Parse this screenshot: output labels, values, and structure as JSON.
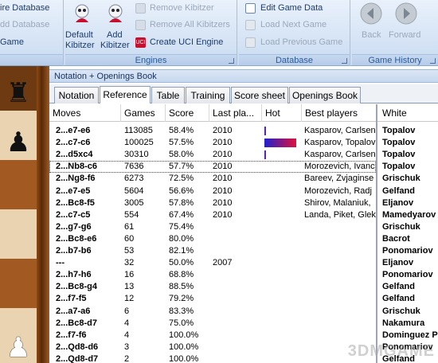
{
  "ribbon": {
    "left_group": {
      "items": [
        "ire Database",
        "dd Database",
        "Game"
      ]
    },
    "engines": {
      "label": "Engines",
      "default_kibitzer_line1": "Default",
      "default_kibitzer_line2": "Kibitzer",
      "add_kibitzer_line1": "Add",
      "add_kibitzer_line2": "Kibitzer",
      "remove_kibitzer": "Remove Kibitzer",
      "remove_all_kibitzers": "Remove All Kibitzers",
      "create_uci_engine": "Create UCI Engine"
    },
    "database": {
      "label": "Database",
      "edit_game_data": "Edit Game Data",
      "load_next_game": "Load Next Game",
      "load_previous_game": "Load Previous Game"
    },
    "game_history": {
      "label": "Game History",
      "back": "Back",
      "forward": "Forward"
    }
  },
  "panel": {
    "title": "Notation + Openings Book",
    "tabs": [
      "Notation",
      "Reference",
      "Table",
      "Training",
      "Score sheet",
      "Openings Book"
    ],
    "active_tab": "Reference"
  },
  "tree": {
    "columns": [
      "Moves",
      "Games",
      "Score",
      "Last pla...",
      "Hot",
      "Best players"
    ],
    "rows": [
      {
        "move": "2...e7-e6",
        "games": "113085",
        "score": "58.4%",
        "last": "2010",
        "hot": 0.06,
        "players": "Kasparov, Carlsen"
      },
      {
        "move": "2...c7-c6",
        "games": "100025",
        "score": "57.5%",
        "last": "2010",
        "hot": 1.0,
        "players": "Kasparov, Topalov"
      },
      {
        "move": "2...d5xc4",
        "games": "30310",
        "score": "58.0%",
        "last": "2010",
        "hot": 0.05,
        "players": "Kasparov, Carlsen"
      },
      {
        "move": "2...Nb8-c6",
        "games": "7636",
        "score": "57.7%",
        "last": "2010",
        "hot": 0,
        "players": "Morozevich, Ivanc"
      },
      {
        "move": "2...Ng8-f6",
        "games": "6273",
        "score": "72.5%",
        "last": "2010",
        "hot": 0,
        "players": "Bareev, Zvjaginse"
      },
      {
        "move": "2...e7-e5",
        "games": "5604",
        "score": "56.6%",
        "last": "2010",
        "hot": 0,
        "players": "Morozevich, Radj"
      },
      {
        "move": "2...Bc8-f5",
        "games": "3005",
        "score": "57.8%",
        "last": "2010",
        "hot": 0,
        "players": "Shirov, Malaniuk,"
      },
      {
        "move": "2...c7-c5",
        "games": "554",
        "score": "67.4%",
        "last": "2010",
        "hot": 0,
        "players": "Landa, Piket, Glek"
      },
      {
        "move": "2...g7-g6",
        "games": "61",
        "score": "75.4%",
        "last": "",
        "hot": 0,
        "players": ""
      },
      {
        "move": "2...Bc8-e6",
        "games": "60",
        "score": "80.0%",
        "last": "",
        "hot": 0,
        "players": ""
      },
      {
        "move": "2...b7-b6",
        "games": "53",
        "score": "82.1%",
        "last": "",
        "hot": 0,
        "players": ""
      },
      {
        "move": "---",
        "games": "32",
        "score": "50.0%",
        "last": "2007",
        "hot": 0,
        "players": ""
      },
      {
        "move": "2...h7-h6",
        "games": "16",
        "score": "68.8%",
        "last": "",
        "hot": 0,
        "players": ""
      },
      {
        "move": "2...Bc8-g4",
        "games": "13",
        "score": "88.5%",
        "last": "",
        "hot": 0,
        "players": ""
      },
      {
        "move": "2...f7-f5",
        "games": "12",
        "score": "79.2%",
        "last": "",
        "hot": 0,
        "players": ""
      },
      {
        "move": "2...a7-a6",
        "games": "6",
        "score": "83.3%",
        "last": "",
        "hot": 0,
        "players": ""
      },
      {
        "move": "2...Bc8-d7",
        "games": "4",
        "score": "75.0%",
        "last": "",
        "hot": 0,
        "players": ""
      },
      {
        "move": "2...f7-f6",
        "games": "4",
        "score": "100.0%",
        "last": "",
        "hot": 0,
        "players": ""
      },
      {
        "move": "2...Qd8-d6",
        "games": "3",
        "score": "100.0%",
        "last": "",
        "hot": 0,
        "players": ""
      },
      {
        "move": "2...Qd8-d7",
        "games": "2",
        "score": "100.0%",
        "last": "",
        "hot": 0,
        "players": ""
      }
    ]
  },
  "players_panel": {
    "header": "White",
    "names": [
      "Topalov",
      "Topalov",
      "Topalov",
      "Topalov",
      "Grischuk",
      "Gelfand",
      "Eljanov",
      "Mamedyarov",
      "Grischuk",
      "Bacrot",
      "Ponomariov",
      "Eljanov",
      "Ponomariov",
      "Gelfand",
      "Gelfand",
      "Grischuk",
      "Nakamura",
      "Dominguez Pe",
      "Ponomariov",
      "Gelfand"
    ]
  },
  "board": {
    "pieces": [
      "black-rook",
      "black-pawn",
      "white-pawn"
    ]
  },
  "watermark": "3DMGAME",
  "colors": {
    "ribbon_text": "#1d3c6a",
    "group_label": "#2a5b9a",
    "hot_bar_start": "#2020d0",
    "hot_bar_end": "#e0103a"
  }
}
